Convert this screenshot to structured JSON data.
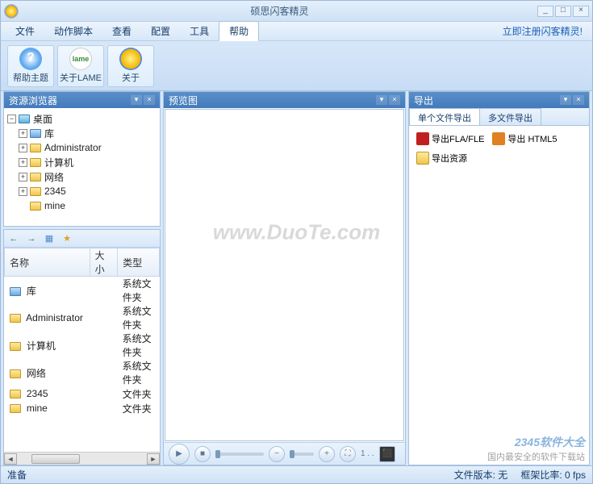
{
  "title": "硕思闪客精灵",
  "window_controls": {
    "min": "_",
    "max": "□",
    "close": "×"
  },
  "menu": {
    "items": [
      "文件",
      "动作脚本",
      "查看",
      "配置",
      "工具",
      "帮助"
    ],
    "active_index": 5,
    "register_link": "立即注册闪客精灵!"
  },
  "toolbar": [
    {
      "icon": "help",
      "label": "帮助主题"
    },
    {
      "icon": "lame",
      "label": "关于LAME",
      "icon_text": "lame"
    },
    {
      "icon": "about",
      "label": "关于"
    }
  ],
  "panels": {
    "explorer": {
      "title": "资源浏览器",
      "pin": "▾",
      "close": "×"
    },
    "preview": {
      "title": "预览图",
      "pin": "▾",
      "close": "×"
    },
    "export": {
      "title": "导出",
      "pin": "▾",
      "close": "×"
    }
  },
  "tree": {
    "root": {
      "label": "桌面",
      "expanded": true
    },
    "children": [
      {
        "label": "库",
        "expandable": true,
        "icon": "blue"
      },
      {
        "label": "Administrator",
        "expandable": true,
        "icon": "folder"
      },
      {
        "label": "计算机",
        "expandable": true,
        "icon": "folder"
      },
      {
        "label": "网络",
        "expandable": true,
        "icon": "folder"
      },
      {
        "label": "2345",
        "expandable": true,
        "icon": "folder"
      },
      {
        "label": "mine",
        "expandable": false,
        "icon": "folder"
      }
    ]
  },
  "file_toolbar": {
    "back": "←",
    "fwd": "→",
    "new": "▦",
    "star": "★"
  },
  "filelist": {
    "columns": [
      "名称",
      "大小",
      "类型"
    ],
    "rows": [
      {
        "name": "库",
        "size": "",
        "type": "系统文件夹",
        "icon": "blue"
      },
      {
        "name": "Administrator",
        "size": "",
        "type": "系统文件夹",
        "icon": "folder"
      },
      {
        "name": "计算机",
        "size": "",
        "type": "系统文件夹",
        "icon": "folder"
      },
      {
        "name": "网络",
        "size": "",
        "type": "系统文件夹",
        "icon": "folder"
      },
      {
        "name": "2345",
        "size": "",
        "type": "文件夹",
        "icon": "folder"
      },
      {
        "name": "mine",
        "size": "",
        "type": "文件夹",
        "icon": "folder"
      }
    ]
  },
  "preview_controls": {
    "play": "▶",
    "stop": "■",
    "zoom_out": "−",
    "zoom_in": "+",
    "fit": "⛶",
    "fullscreen": "⬛",
    "frame_label": "1 . ."
  },
  "export": {
    "tabs": [
      "单个文件导出",
      "多文件导出"
    ],
    "active_tab": 0,
    "items": [
      {
        "icon": "fla",
        "label": "导出FLA/FLE"
      },
      {
        "icon": "html5",
        "label": "导出 HTML5"
      },
      {
        "icon": "res",
        "label": "导出资源"
      }
    ]
  },
  "statusbar": {
    "ready": "准备",
    "file_version": "文件版本: 无",
    "frame_rate": "框架比率: 0 fps"
  },
  "watermark": "www.DuoTe.com",
  "brand": {
    "line1": "2345软件大全",
    "line2": "国内最安全的软件下载站"
  }
}
